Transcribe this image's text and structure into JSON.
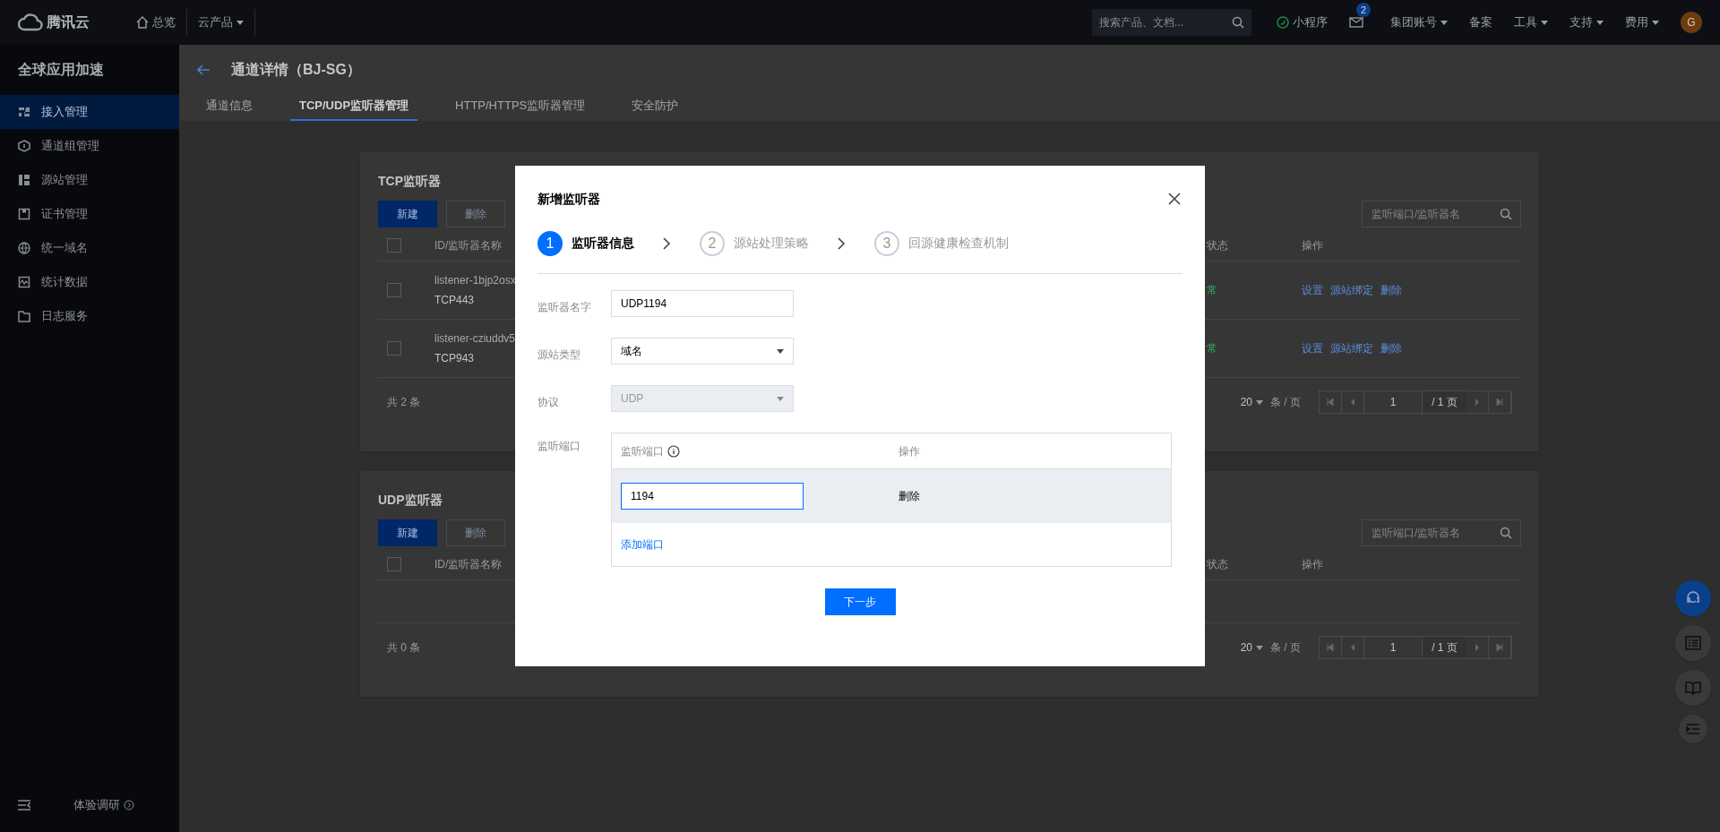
{
  "topbar": {
    "logo": "腾讯云",
    "nav": [
      {
        "label": "总览",
        "kind": "home"
      },
      {
        "label": "云产品",
        "kind": "dropdown"
      }
    ],
    "search": {
      "placeholder": "搜索产品、文档..."
    },
    "right": [
      {
        "label": "小程序",
        "kind": "mini"
      },
      {
        "kind": "mail",
        "badge": "2"
      },
      {
        "label": "集团账号",
        "kind": "dropdown"
      },
      {
        "label": "备案",
        "kind": "plain"
      },
      {
        "label": "工具",
        "kind": "dropdown"
      },
      {
        "label": "支持",
        "kind": "dropdown"
      },
      {
        "label": "费用",
        "kind": "dropdown"
      }
    ],
    "avatar": "G"
  },
  "sidebar": {
    "title": "全球应用加速",
    "items": [
      {
        "label": "接入管理",
        "selected": true
      },
      {
        "label": "通道组管理",
        "selected": false
      },
      {
        "label": "源站管理",
        "selected": false
      },
      {
        "label": "证书管理",
        "selected": false
      },
      {
        "label": "统一域名",
        "selected": false
      },
      {
        "label": "统计数据",
        "selected": false
      },
      {
        "label": "日志服务",
        "selected": false
      }
    ],
    "survey": "体验调研"
  },
  "header": {
    "title": "通道详情（BJ-SG）",
    "tabs": [
      {
        "label": "通道信息",
        "selected": false
      },
      {
        "label": "TCP/UDP监听器管理",
        "selected": true
      },
      {
        "label": "HTTP/HTTPS监听器管理",
        "selected": false
      },
      {
        "label": "安全防护",
        "selected": false
      }
    ]
  },
  "panels": [
    {
      "title": "TCP监听器",
      "buttons": [
        {
          "label": "新建",
          "kind": "primary"
        },
        {
          "label": "删除",
          "kind": "disabled"
        }
      ],
      "search_placeholder": "监听端口/监听器名",
      "all_checked": false,
      "columns": [
        "ID/监听器名称",
        "状态",
        "操作"
      ],
      "rows": [
        {
          "checked": false,
          "id": "listener-1bjp2osx",
          "name": "TCP443",
          "status": "常",
          "actions": [
            "设置",
            "源站绑定",
            "删除"
          ]
        },
        {
          "checked": false,
          "id": "listener-cziuddv5",
          "name": "TCP943",
          "status": "常",
          "actions": [
            "设置",
            "源站绑定",
            "删除"
          ]
        }
      ],
      "total": "共 2 条",
      "page_size": "20",
      "per_page": "条 / 页",
      "page": "1",
      "pages": "/ 1 页"
    },
    {
      "title": "UDP监听器",
      "buttons": [
        {
          "label": "新建",
          "kind": "primary"
        },
        {
          "label": "删除",
          "kind": "disabled"
        }
      ],
      "search_placeholder": "监听端口/监听器名",
      "all_checked": false,
      "columns": [
        "ID/监听器名称",
        "状态",
        "操作"
      ],
      "total": "共 0 条",
      "page_size": "20",
      "per_page": "条 / 页",
      "page": "1",
      "pages": "/ 1 页"
    }
  ],
  "dialog": {
    "title": "新增监听器",
    "steps": [
      {
        "number": "1",
        "label": "监听器信息",
        "selected": true
      },
      {
        "number": "2",
        "label": "源站处理策略",
        "selected": false
      },
      {
        "number": "3",
        "label": "回源健康检查机制",
        "selected": false
      }
    ],
    "fields": [
      {
        "label": "监听器名字",
        "kind": "text",
        "value": "UDP1194",
        "disabled": false
      },
      {
        "label": "源站类型",
        "kind": "select",
        "value": "域名",
        "disabled": false
      },
      {
        "label": "协议",
        "kind": "select",
        "value": "UDP",
        "disabled": true
      }
    ],
    "ports": {
      "label": "监听端口",
      "columns": [
        "监听端口",
        "操作"
      ],
      "rows": [
        {
          "value": "1194",
          "action": "删除"
        }
      ],
      "add": "添加端口"
    },
    "next": "下一步"
  }
}
